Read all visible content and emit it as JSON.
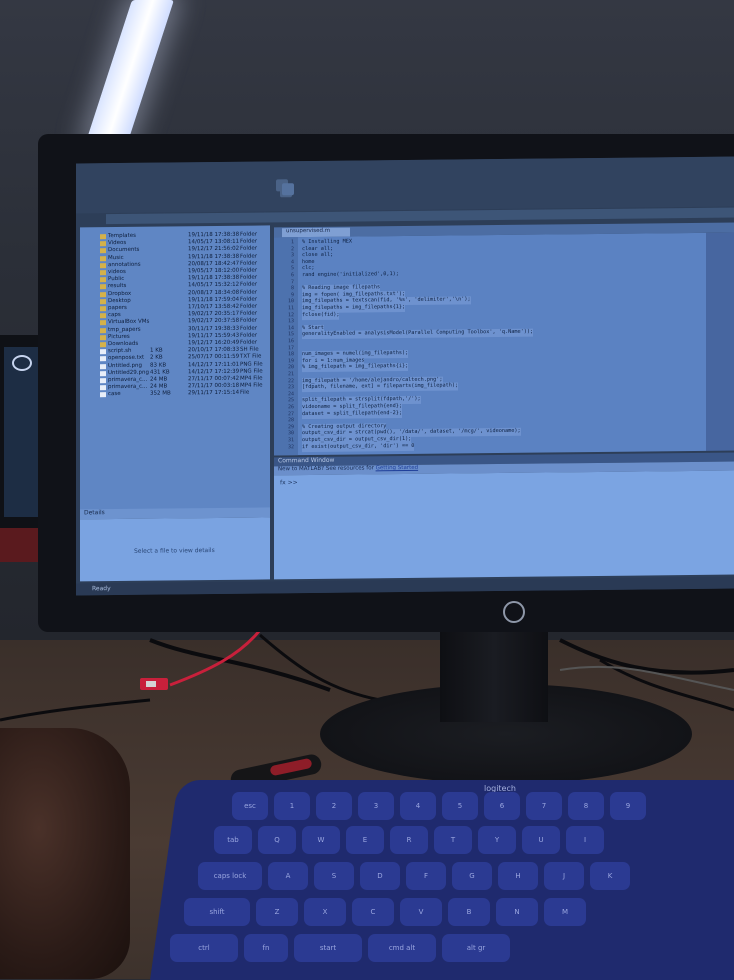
{
  "scene": {
    "description_tag": "photo of desktop monitor showing MATLAB IDE",
    "colors": {
      "screen_tint": "#5b82c2",
      "keyboard": "#1f2a6e",
      "cable_red": "#c8203b"
    }
  },
  "app": {
    "status": "Ready",
    "files": [
      {
        "name": "Templates",
        "date": "19/11/18 17:38:38",
        "type": "Folder"
      },
      {
        "name": "Videos",
        "date": "14/05/17 13:08:11",
        "type": "Folder"
      },
      {
        "name": "Documents",
        "date": "19/12/17 21:56:02",
        "type": "Folder"
      },
      {
        "name": "Music",
        "date": "19/11/18 17:38:38",
        "type": "Folder"
      },
      {
        "name": "annotations",
        "date": "20/08/17 18:42:47",
        "type": "Folder"
      },
      {
        "name": "videos",
        "date": "19/05/17 18:12:00",
        "type": "Folder"
      },
      {
        "name": "Public",
        "date": "19/11/18 17:38:38",
        "type": "Folder"
      },
      {
        "name": "results",
        "date": "14/05/17 15:32:12",
        "type": "Folder"
      },
      {
        "name": "Dropbox",
        "date": "20/08/17 18:34:08",
        "type": "Folder"
      },
      {
        "name": "Desktop",
        "date": "19/11/18 17:59:04",
        "type": "Folder"
      },
      {
        "name": "papers",
        "date": "17/10/17 13:58:42",
        "type": "Folder"
      },
      {
        "name": "caps",
        "date": "19/02/17 20:35:17",
        "type": "Folder"
      },
      {
        "name": "VirtualBox VMs",
        "date": "19/02/17 20:37:58",
        "type": "Folder"
      },
      {
        "name": "tmp_papers",
        "date": "30/11/17 19:38:33",
        "type": "Folder"
      },
      {
        "name": "Pictures",
        "date": "19/11/17 15:59:43",
        "type": "Folder"
      },
      {
        "name": "Downloads",
        "date": "19/12/17 16:20:49",
        "type": "Folder"
      },
      {
        "name": "script.sh",
        "size": "1 KB",
        "date": "20/10/17 17:08:33",
        "type": "SH File"
      },
      {
        "name": "openpose.txt",
        "size": "2 KB",
        "date": "25/07/17 00:11:59",
        "type": "TXT File"
      },
      {
        "name": "Untitled.png",
        "size": "83 KB",
        "date": "14/12/17 17:11:01",
        "type": "PNG File"
      },
      {
        "name": "Untitled29.png",
        "size": "431 KB",
        "date": "14/12/17 17:12:39",
        "type": "PNG File"
      },
      {
        "name": "primavera_c...",
        "size": "24 MB",
        "date": "27/11/17 00:07:42",
        "type": "MP4 File"
      },
      {
        "name": "primavera_c...",
        "size": "24 MB",
        "date": "27/11/17 00:03:18",
        "type": "MP4 File"
      },
      {
        "name": "case",
        "size": "352 MB",
        "date": "29/11/17 17:15:14",
        "type": "File"
      }
    ],
    "details": {
      "header": "Details",
      "placeholder": "Select a file to view details"
    },
    "editor": {
      "tab": "unsupervised.m",
      "lines": [
        {
          "n": "1",
          "text": "% Installing MEX",
          "hl": false
        },
        {
          "n": "2",
          "text": "clear all;",
          "hl": false
        },
        {
          "n": "3",
          "text": "close all;",
          "hl": false
        },
        {
          "n": "4",
          "text": "home",
          "hl": false
        },
        {
          "n": "5",
          "text": "clc;",
          "hl": false
        },
        {
          "n": "6",
          "text": "rand engine('initialized',0,1);",
          "hl": false
        },
        {
          "n": "7",
          "text": "",
          "hl": false
        },
        {
          "n": "8",
          "text": "% Reading image filepaths",
          "hl": true
        },
        {
          "n": "9",
          "text": "img = fopen( img_filepaths.txt');",
          "hl": true
        },
        {
          "n": "10",
          "text": "img_filepaths = textscan(fid, '%s', 'delimiter','\\n');",
          "hl": true
        },
        {
          "n": "11",
          "text": "img_filepaths = img_filepaths{1};",
          "hl": true
        },
        {
          "n": "12",
          "text": "fclose(fid);",
          "hl": true
        },
        {
          "n": "13",
          "text": "",
          "hl": false
        },
        {
          "n": "14",
          "text": "% Start",
          "hl": true
        },
        {
          "n": "15",
          "text": "generalityEnabled = analysisModel(Parallel Computing Toolbox', 'q.Name'));",
          "hl": true
        },
        {
          "n": "16",
          "text": "",
          "hl": false
        },
        {
          "n": "17",
          "text": "",
          "hl": false
        },
        {
          "n": "18",
          "text": "num_images = numel(img_filepaths);",
          "hl": true
        },
        {
          "n": "19",
          "text": "for i = 1:num_images",
          "hl": true
        },
        {
          "n": "20",
          "text": "    % img_filepath = img_filepaths{i};",
          "hl": true
        },
        {
          "n": "21",
          "text": "",
          "hl": false
        },
        {
          "n": "22",
          "text": "    img_filepath = '/home/alejandro/caltech.png';",
          "hl": true
        },
        {
          "n": "23",
          "text": "    [fdpath, filename, ext] = fileparts(img_filepath);",
          "hl": true
        },
        {
          "n": "24",
          "text": "",
          "hl": false
        },
        {
          "n": "25",
          "text": "    split_filepath = strsplit(fdpath,'/');",
          "hl": true
        },
        {
          "n": "26",
          "text": "    videoname = split_filepath{end};",
          "hl": true
        },
        {
          "n": "27",
          "text": "    dataset = split_filepath{end-2};",
          "hl": true
        },
        {
          "n": "28",
          "text": "",
          "hl": false
        },
        {
          "n": "29",
          "text": "    % Creating output directory",
          "hl": true
        },
        {
          "n": "30",
          "text": "    output_csv_dir = strcat(pwd(), '/data/', dataset, '/mcg/', videoname);",
          "hl": true
        },
        {
          "n": "31",
          "text": "    output_csv_dir = output_csv_dir(1);",
          "hl": true
        },
        {
          "n": "32",
          "text": "    if exist(output_csv_dir, 'dir') == 0",
          "hl": true
        }
      ]
    },
    "command_window": {
      "header": "Command Window",
      "banner_prefix": "New to MATLAB? See resources for ",
      "banner_link": "Getting Started",
      "prompt": "fx >>"
    }
  },
  "keyboard": {
    "brand": "logitech",
    "keys": [
      "esc",
      "1",
      "2",
      "3",
      "4",
      "5",
      "6",
      "7",
      "8",
      "9",
      "tab",
      "Q",
      "W",
      "E",
      "R",
      "T",
      "Y",
      "U",
      "I",
      "caps lock",
      "A",
      "S",
      "D",
      "F",
      "G",
      "H",
      "J",
      "K",
      "shift",
      "Z",
      "X",
      "C",
      "V",
      "B",
      "N",
      "M",
      "ctrl",
      "fn",
      "start",
      "cmd alt",
      "alt gr"
    ]
  }
}
